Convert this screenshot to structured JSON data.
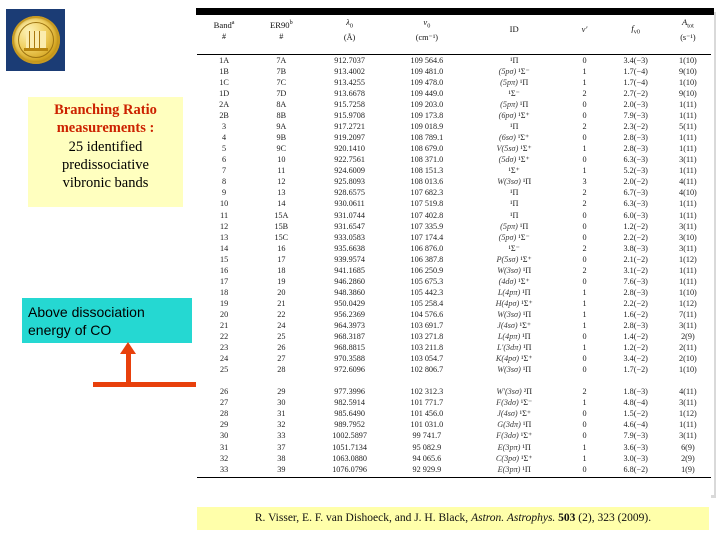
{
  "logo": {
    "name": "university-seal",
    "bg_color": "#1b3c75",
    "coin_color": "#e8c24a"
  },
  "callouts": {
    "branching": {
      "bg_color": "#ffffbf",
      "accent_color": "#cc2200",
      "line1": "Branching Ratio",
      "line2": "measurements :",
      "line3": "25 identified",
      "line4": "predissociative",
      "line5": "vibronic bands"
    },
    "dissociation": {
      "bg_color": "#25d8d2",
      "line1": "Above dissociation",
      "line2": "energy of CO"
    }
  },
  "marker": {
    "name": "dissociation-threshold-line",
    "color": "#e8400c"
  },
  "table": {
    "headers": [
      {
        "top": "Band",
        "sup": "a",
        "bottom": "#"
      },
      {
        "top": "ER90",
        "sup": "b",
        "bottom": "#"
      },
      {
        "top": "λ",
        "sub": "0",
        "bottom": "(Å)"
      },
      {
        "top": "ν",
        "sub": "0",
        "bottom": "(cm⁻¹)"
      },
      {
        "top": "ID",
        "bottom": ""
      },
      {
        "top": "v′",
        "bottom": ""
      },
      {
        "top": "f",
        "sub": "v0",
        "bottom": ""
      },
      {
        "top": "A",
        "sub": "tot",
        "bottom": "(s⁻¹)"
      }
    ],
    "rows": [
      {
        "band": "1A",
        "er": "7A",
        "lam": "912.7037",
        "nu": "109 564.6",
        "pre": "",
        "state": "¹Π",
        "v": "0",
        "f": "3.4(−3)",
        "a": "1(10)"
      },
      {
        "band": "1B",
        "er": "7B",
        "lam": "913.4002",
        "nu": "109 481.0",
        "pre": "(5pσ)",
        "state": "¹Σ⁻",
        "v": "1",
        "f": "1.7(−4)",
        "a": "9(10)"
      },
      {
        "band": "1C",
        "er": "7C",
        "lam": "913.4255",
        "nu": "109 478.0",
        "pre": "(5pπ)",
        "state": "¹Π",
        "v": "1",
        "f": "1.7(−4)",
        "a": "1(10)"
      },
      {
        "band": "1D",
        "er": "7D",
        "lam": "913.6678",
        "nu": "109 449.0",
        "pre": "",
        "state": "¹Σ⁻",
        "v": "2",
        "f": "2.7(−2)",
        "a": "9(10)"
      },
      {
        "band": "2A",
        "er": "8A",
        "lam": "915.7258",
        "nu": "109 203.0",
        "pre": "(5pπ)",
        "state": "¹Π",
        "v": "0",
        "f": "2.0(−3)",
        "a": "1(11)"
      },
      {
        "band": "2B",
        "er": "8B",
        "lam": "915.9708",
        "nu": "109 173.8",
        "pre": "(6pσ)",
        "state": "¹Σ⁺",
        "v": "0",
        "f": "7.9(−3)",
        "a": "1(11)"
      },
      {
        "band": "3",
        "er": "9A",
        "lam": "917.2721",
        "nu": "109 018.9",
        "pre": "",
        "state": "¹Π",
        "v": "2",
        "f": "2.3(−2)",
        "a": "5(11)"
      },
      {
        "band": "4",
        "er": "9B",
        "lam": "919.2097",
        "nu": "108 789.1",
        "pre": "(6sσ)",
        "state": "¹Σ⁺",
        "v": "0",
        "f": "2.8(−3)",
        "a": "1(11)"
      },
      {
        "band": "5",
        "er": "9C",
        "lam": "920.1410",
        "nu": "108 679.0",
        "pre": "V(5sσ)",
        "state": "¹Σ⁺",
        "v": "1",
        "f": "2.8(−3)",
        "a": "1(11)"
      },
      {
        "band": "6",
        "er": "10",
        "lam": "922.7561",
        "nu": "108 371.0",
        "pre": "(5dσ)",
        "state": "¹Σ⁺",
        "v": "0",
        "f": "6.3(−3)",
        "a": "3(11)"
      },
      {
        "band": "7",
        "er": "11",
        "lam": "924.6009",
        "nu": "108 151.3",
        "pre": "",
        "state": "¹Σ⁺",
        "v": "1",
        "f": "5.2(−3)",
        "a": "1(11)"
      },
      {
        "band": "8",
        "er": "12",
        "lam": "925.8093",
        "nu": "108 013.6",
        "pre": "W(3sσ)",
        "state": "¹Π",
        "v": "3",
        "f": "2.0(−2)",
        "a": "4(11)"
      },
      {
        "band": "9",
        "er": "13",
        "lam": "928.6575",
        "nu": "107 682.3",
        "pre": "",
        "state": "¹Π",
        "v": "2",
        "f": "6.7(−3)",
        "a": "4(10)"
      },
      {
        "band": "10",
        "er": "14",
        "lam": "930.0611",
        "nu": "107 519.8",
        "pre": "",
        "state": "¹Π",
        "v": "2",
        "f": "6.3(−3)",
        "a": "1(11)"
      },
      {
        "band": "11",
        "er": "15A",
        "lam": "931.0744",
        "nu": "107 402.8",
        "pre": "",
        "state": "¹Π",
        "v": "0",
        "f": "6.0(−3)",
        "a": "1(11)"
      },
      {
        "band": "12",
        "er": "15B",
        "lam": "931.6547",
        "nu": "107 335.9",
        "pre": "(5pπ)",
        "state": "¹Π",
        "v": "0",
        "f": "1.2(−2)",
        "a": "3(11)"
      },
      {
        "band": "13",
        "er": "15C",
        "lam": "933.0583",
        "nu": "107 174.4",
        "pre": "(5pσ)",
        "state": "¹Σ⁻",
        "v": "0",
        "f": "2.2(−2)",
        "a": "3(10)"
      },
      {
        "band": "14",
        "er": "16",
        "lam": "935.6638",
        "nu": "106 876.0",
        "pre": "",
        "state": "¹Σ⁻",
        "v": "2",
        "f": "3.8(−3)",
        "a": "3(11)"
      },
      {
        "band": "15",
        "er": "17",
        "lam": "939.9574",
        "nu": "106 387.8",
        "pre": "P(5sσ)",
        "state": "¹Σ⁺",
        "v": "0",
        "f": "2.1(−2)",
        "a": "1(12)"
      },
      {
        "band": "16",
        "er": "18",
        "lam": "941.1685",
        "nu": "106 250.9",
        "pre": "W(3sσ)",
        "state": "¹Π",
        "v": "2",
        "f": "3.1(−2)",
        "a": "1(11)"
      },
      {
        "band": "17",
        "er": "19",
        "lam": "946.2860",
        "nu": "105 675.3",
        "pre": "(4dσ)",
        "state": "¹Σ⁺",
        "v": "0",
        "f": "7.6(−3)",
        "a": "1(11)"
      },
      {
        "band": "18",
        "er": "20",
        "lam": "948.3860",
        "nu": "105 442.3",
        "pre": "L(4pπ)",
        "state": "¹Π",
        "v": "1",
        "f": "2.8(−3)",
        "a": "1(10)"
      },
      {
        "band": "19",
        "er": "21",
        "lam": "950.0429",
        "nu": "105 258.4",
        "pre": "H(4pσ)",
        "state": "¹Σ⁺",
        "v": "1",
        "f": "2.2(−2)",
        "a": "1(12)"
      },
      {
        "band": "20",
        "er": "22",
        "lam": "956.2369",
        "nu": "104 576.6",
        "pre": "W(3sσ)",
        "state": "¹Π",
        "v": "1",
        "f": "1.6(−2)",
        "a": "7(11)"
      },
      {
        "band": "21",
        "er": "24",
        "lam": "964.3973",
        "nu": "103 691.7",
        "pre": "J(4sσ)",
        "state": "¹Σ⁺",
        "v": "1",
        "f": "2.8(−3)",
        "a": "3(11)"
      },
      {
        "band": "22",
        "er": "25",
        "lam": "968.3187",
        "nu": "103 271.8",
        "pre": "L(4pπ)",
        "state": "¹Π",
        "v": "0",
        "f": "1.4(−2)",
        "a": "2(9)"
      },
      {
        "band": "23",
        "er": "26",
        "lam": "968.8815",
        "nu": "103 211.8",
        "pre": "L′(3dπ)",
        "state": "¹Π",
        "v": "1",
        "f": "1.2(−2)",
        "a": "2(11)"
      },
      {
        "band": "24",
        "er": "27",
        "lam": "970.3588",
        "nu": "103 054.7",
        "pre": "K(4pσ)",
        "state": "¹Σ⁺",
        "v": "0",
        "f": "3.4(−2)",
        "a": "2(10)"
      },
      {
        "band": "25",
        "er": "28",
        "lam": "972.6096",
        "nu": "102 806.7",
        "pre": "W(3sσ)",
        "state": "¹Π",
        "v": "0",
        "f": "1.7(−2)",
        "a": "1(10)"
      },
      {
        "band": "26",
        "er": "29",
        "lam": "977.3996",
        "nu": "102 312.3",
        "pre": "W′(3sσ)",
        "state": "²Π",
        "v": "2",
        "f": "1.8(−3)",
        "a": "4(11)"
      },
      {
        "band": "27",
        "er": "30",
        "lam": "982.5914",
        "nu": "101 771.7",
        "pre": "F(3dσ)",
        "state": "¹Σ⁻",
        "v": "1",
        "f": "4.8(−4)",
        "a": "3(11)"
      },
      {
        "band": "28",
        "er": "31",
        "lam": "985.6490",
        "nu": "101 456.0",
        "pre": "J(4sσ)",
        "state": "¹Σ⁺",
        "v": "0",
        "f": "1.5(−2)",
        "a": "1(12)"
      },
      {
        "band": "29",
        "er": "32",
        "lam": "989.7952",
        "nu": "101 031.0",
        "pre": "G(3dπ)",
        "state": "¹Π",
        "v": "0",
        "f": "4.6(−4)",
        "a": "1(11)"
      },
      {
        "band": "30",
        "er": "33",
        "lam": "1002.5897",
        "nu": "99 741.7",
        "pre": "F(3dσ)",
        "state": "¹Σ⁺",
        "v": "0",
        "f": "7.9(−3)",
        "a": "3(11)"
      },
      {
        "band": "31",
        "er": "37",
        "lam": "1051.7134",
        "nu": "95 082.9",
        "pre": "E(3pπ)",
        "state": "¹Π",
        "v": "1",
        "f": "3.6(−3)",
        "a": "6(9)"
      },
      {
        "band": "32",
        "er": "38",
        "lam": "1063.0880",
        "nu": "94 065.6",
        "pre": "C(3pσ)",
        "state": "¹Σ⁺",
        "v": "1",
        "f": "3.0(−3)",
        "a": "2(9)"
      },
      {
        "band": "33",
        "er": "39",
        "lam": "1076.0796",
        "nu": "92 929.9",
        "pre": "E(3pπ)",
        "state": "¹Π",
        "v": "0",
        "f": "6.8(−2)",
        "a": "1(9)"
      }
    ],
    "split_after_row_index": 28
  },
  "citation": {
    "authors": "R. Visser, E. F. van Dishoeck, and J. H. Black,",
    "journal": "Astron. Astrophys.",
    "volume": "503",
    "issue": "(2),",
    "pages": "323",
    "year": "(2009)."
  }
}
